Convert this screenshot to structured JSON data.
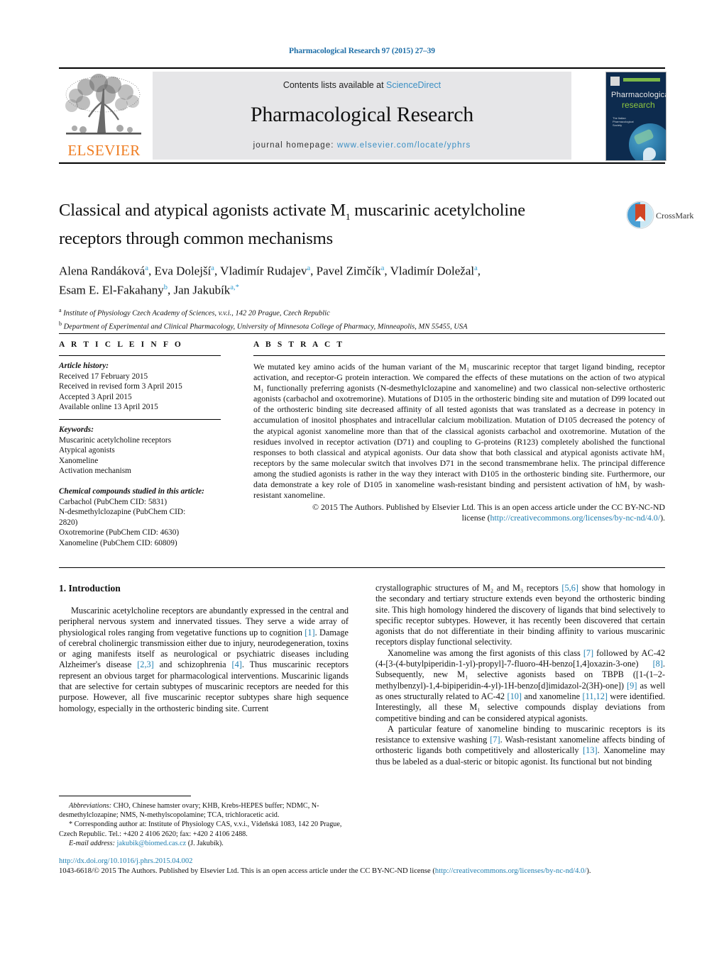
{
  "running_head": "Pharmacological Research 97 (2015) 27–39",
  "masthead": {
    "elsevier_wordmark": "ELSEVIER",
    "contents_prefix": "Contents lists available at ",
    "contents_link": "ScienceDirect",
    "journal_title": "Pharmacological Research",
    "homepage_prefix": "journal homepage: ",
    "homepage_url": "www.elsevier.com/locate/yphrs",
    "cover": {
      "line1": "Pharmacological",
      "line2": "research",
      "badge_text": "The Italian Pharmacological Society"
    },
    "colors": {
      "elsevier_orange": "#ef7d22",
      "link_blue": "#3a8fc4",
      "band_grey": "#e6e6e8",
      "cover_navy": "#0d2b4e",
      "cover_green": "#7ab648"
    }
  },
  "crossmark": {
    "label": "CrossMark"
  },
  "article": {
    "title_line1": "Classical and atypical agonists activate M",
    "title_sub1": "1",
    "title_line1b": " muscarinic acetylcholine",
    "title_line2": "receptors through common mechanisms",
    "authors_line1": "Alena Randáková",
    "authors_line1_rest": ", Eva Dolejší",
    "authors_full_1": "Alena Randáková a , Eva Dolejší a , Vladimír Rudajev a , Pavel Zimčík a , Vladimír Doležal a ,",
    "authors_full_2": "Esam E. El-Fakahany b , Jan Jakubík a,*",
    "affiliation_a": "Institute of Physiology Czech Academy of Sciences, v.v.i., 142 20 Prague, Czech Republic",
    "affiliation_b": "Department of Experimental and Clinical Pharmacology, University of Minnesota College of Pharmacy, Minneapolis, MN 55455, USA"
  },
  "article_info": {
    "heading": "A R T I C L E    I N F O",
    "history_label": "Article history:",
    "history": [
      "Received 17 February 2015",
      "Received in revised form 3 April 2015",
      "Accepted 3 April 2015",
      "Available online 13 April 2015"
    ],
    "keywords_label": "Keywords:",
    "keywords": [
      "Muscarinic acetylcholine receptors",
      "Atypical agonists",
      "Xanomeline",
      "Activation mechanism"
    ],
    "compounds_label": "Chemical compounds studied in this article:",
    "compounds": [
      "Carbachol (PubChem CID: 5831)",
      "N-desmethylclozapine (PubChem CID:",
      "2820)",
      "Oxotremorine (PubChem CID: 4630)",
      "Xanomeline (PubChem CID: 60809)"
    ]
  },
  "abstract": {
    "heading": "A B S T R A C T",
    "body": "We mutated key amino acids of the human variant of the M₁ muscarinic receptor that target ligand binding, receptor activation, and receptor-G protein interaction. We compared the effects of these mutations on the action of two atypical M₁ functionally preferring agonists (N-desmethylclozapine and xanomeline) and two classical non-selective orthosteric agonists (carbachol and oxotremorine). Mutations of D105 in the orthosteric binding site and mutation of D99 located out of the orthosteric binding site decreased affinity of all tested agonists that was translated as a decrease in potency in accumulation of inositol phosphates and intracellular calcium mobilization. Mutation of D105 decreased the potency of the atypical agonist xanomeline more than that of the classical agonists carbachol and oxotremorine. Mutation of the residues involved in receptor activation (D71) and coupling to G-proteins (R123) completely abolished the functional responses to both classical and atypical agonists. Our data show that both classical and atypical agonists activate hM₁ receptors by the same molecular switch that involves D71 in the second transmembrane helix. The principal difference among the studied agonists is rather in the way they interact with D105 in the orthosteric binding site. Furthermore, our data demonstrate a key role of D105 in xanomeline wash-resistant binding and persistent activation of hM₁ by wash-resistant xanomeline.",
    "copyright_pre": "© 2015 The Authors. Published by Elsevier Ltd. This is an open access article under the CC BY-NC-ND",
    "license_pre": "license (",
    "license_url": "http://creativecommons.org/licenses/by-nc-nd/4.0/",
    "license_post": ")."
  },
  "body": {
    "section1_heading": "1.  Introduction",
    "left_p1_part1": "Muscarinic acetylcholine receptors are abundantly expressed in the central and peripheral nervous system and innervated tissues. They serve a wide array of physiological roles ranging from vegetative functions up to cognition ",
    "left_p1_ref1": "[1]",
    "left_p1_part2": ". Damage of cerebral cholinergic transmission either due to injury, neurodegeneration, toxins or aging manifests itself as neurological or psychiatric diseases including Alzheimer's disease ",
    "left_p1_ref2": "[2,3]",
    "left_p1_part3": " and schizophrenia ",
    "left_p1_ref3": "[4]",
    "left_p1_part4": ". Thus muscarinic receptors represent an obvious target for pharmacological interventions. Muscarinic ligands that are selective for certain subtypes of muscarinic receptors are needed for this purpose. However, all five muscarinic receptor subtypes share high sequence homology, especially in the orthosteric binding site. Current",
    "right_p1_part1": "crystallographic structures of M₂ and M₃ receptors ",
    "right_p1_ref1": "[5,6]",
    "right_p1_part2": " show that homology in the secondary and tertiary structure extends even beyond the orthosteric binding site. This high homology hindered the discovery of ligands that bind selectively to specific receptor subtypes. However, it has recently been discovered that certain agonists that do not differentiate in their binding affinity to various muscarinic receptors display functional selectivity.",
    "right_p2_part1": "Xanomeline was among the first agonists of this class ",
    "right_p2_ref1": "[7]",
    "right_p2_part2": " followed by AC-42 (4-[3-(4-butylpiperidin-1-yl)-propyl]-7-fluoro-4H-benzo[1,4]oxazin-3-one) ",
    "right_p2_ref2": "[8]",
    "right_p2_part3": ". Subsequently, new M₁ selective agonists based on TBPB ([1-(1–2-methylbenzyl)-1,4-bipiperidin-4-yl)-1H-benzo[d]imidazol-2(3H)-one]) ",
    "right_p2_ref3": "[9]",
    "right_p2_part4": " as well as ones structurally related to AC-42 ",
    "right_p2_ref4": "[10]",
    "right_p2_part5": " and xanomeline ",
    "right_p2_ref5": "[11,12]",
    "right_p2_part6": " were identified. Interestingly, all these M₁ selective compounds display deviations from competitive binding and can be considered atypical agonists.",
    "right_p3_part1": "A particular feature of xanomeline binding to muscarinic receptors is its resistance to extensive washing ",
    "right_p3_ref1": "[7]",
    "right_p3_part2": ". Wash-resistant xanomeline affects binding of orthosteric ligands both competitively and allosterically ",
    "right_p3_ref2": "[13]",
    "right_p3_part3": ". Xanomeline may thus be labeled as a dual-steric or bitopic agonist. Its functional but not binding"
  },
  "footnotes": {
    "abbrev_label": "Abbreviations:",
    "abbrev_text": " CHO, Chinese hamster ovary; KHB, Krebs-HEPES buffer; NDMC, N-desmethylclozapine; NMS, N-methylscopolamine; TCA, trichloracetic acid.",
    "corresponding": "* Corresponding author at: Institute of Physiology CAS, v.v.i., Vídeňská 1083, 142 20 Prague, Czech Republic. Tel.: +420 2 4106 2620; fax: +420 2 4106 2488.",
    "email_label": "E-mail address:",
    "email": "jakubik@biomed.cas.cz",
    "email_owner": " (J. Jakubík)."
  },
  "bottom": {
    "doi": "http://dx.doi.org/10.1016/j.phrs.2015.04.002",
    "issn_line_pre": "1043-6618/© 2015 The Authors. Published by Elsevier Ltd. This is an open access article under the CC BY-NC-ND license (",
    "issn_link": "http://creativecommons.org/licenses/by-nc-nd/4.0/",
    "issn_line_post": ")."
  }
}
